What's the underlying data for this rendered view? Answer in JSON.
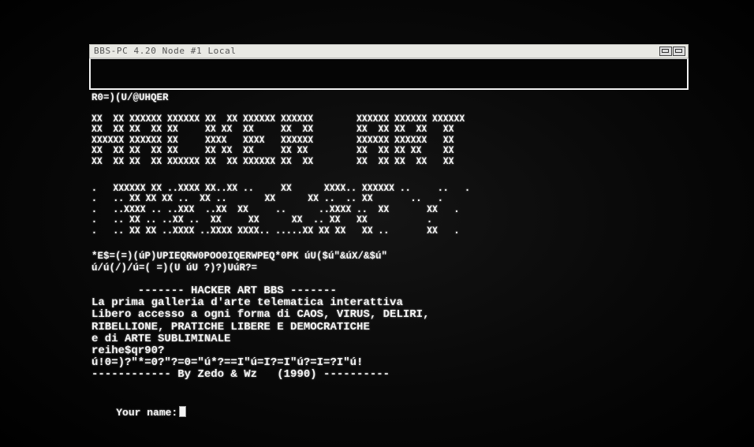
{
  "window": {
    "title": "BBS-PC 4.20 Node #1 Local",
    "minimize_icon": "minimize-icon",
    "maximize_icon": "maximize-icon"
  },
  "terminal": {
    "first_line": "R0=)(U/@UHQER",
    "banner_line1": [
      "XX  XX XXXXXX XXXXXX XX  XX XXXXXX XXXXXX        XXXXXX XXXXXX XXXXXX",
      "XX  XX XX  XX XX     XX XX  XX     XX  XX        XX  XX XX  XX   XX",
      "XXXXXX XXXXXX XX     XXXX   XXXX   XXXXXX        XXXXXX XXXXXX   XX",
      "XX  XX XX  XX XX     XX XX  XX     XX XX         XX  XX XX XX    XX",
      "XX  XX XX  XX XXXXXX XX  XX XXXXXX XX  XX        XX  XX XX  XX   XX"
    ],
    "banner_line2": [
      ".   XXXXXX XX ..XXXX XX..XX ..     XX      XXXX.. XXXXXX ..     ..   .",
      ".   .. XX XX XX ..  XX ..       XX      XX ..  .. XX       ..   .",
      ".   ..XXXX .. ..XXX  ..XX  XX     ..      ..XXXX ..  XX       XX   .",
      ".   .. XX .. ..XX ..  XX     XX      XX  .. XX   XX           .",
      ".   .. XX XX ..XXXX ..XXXX XXXX.. .....XX XX XX   XX ..       XX   ."
    ],
    "noise_line1": "*E$=(=)(úP)UPIEQRW0POO0IQERWPEQ*0PK úU($ú\"&úX/&$ú\"",
    "noise_line2": "ú/ú(/)/ú=( =)(U úU ?)?)UúR?=",
    "info_lines": [
      "       ------- HACKER ART BBS -------",
      "La prima galleria d'arte telematica interattiva",
      "Libero accesso a ogni forma di CAOS, VIRUS, DELIRI,",
      "RIBELLIONE, PRATICHE LIBERE E DEMOCRATICHE",
      "e di ARTE SUBLIMINALE",
      "reihe$qr90?",
      "ú!0=)?\"*=0?\"?=0=\"ú*?==I\"ú=I?=I\"ú?=I=?I\"ú!",
      "------------ By Zedo & Wz   (1990) ----------"
    ],
    "prompt_label": "Your name:"
  }
}
